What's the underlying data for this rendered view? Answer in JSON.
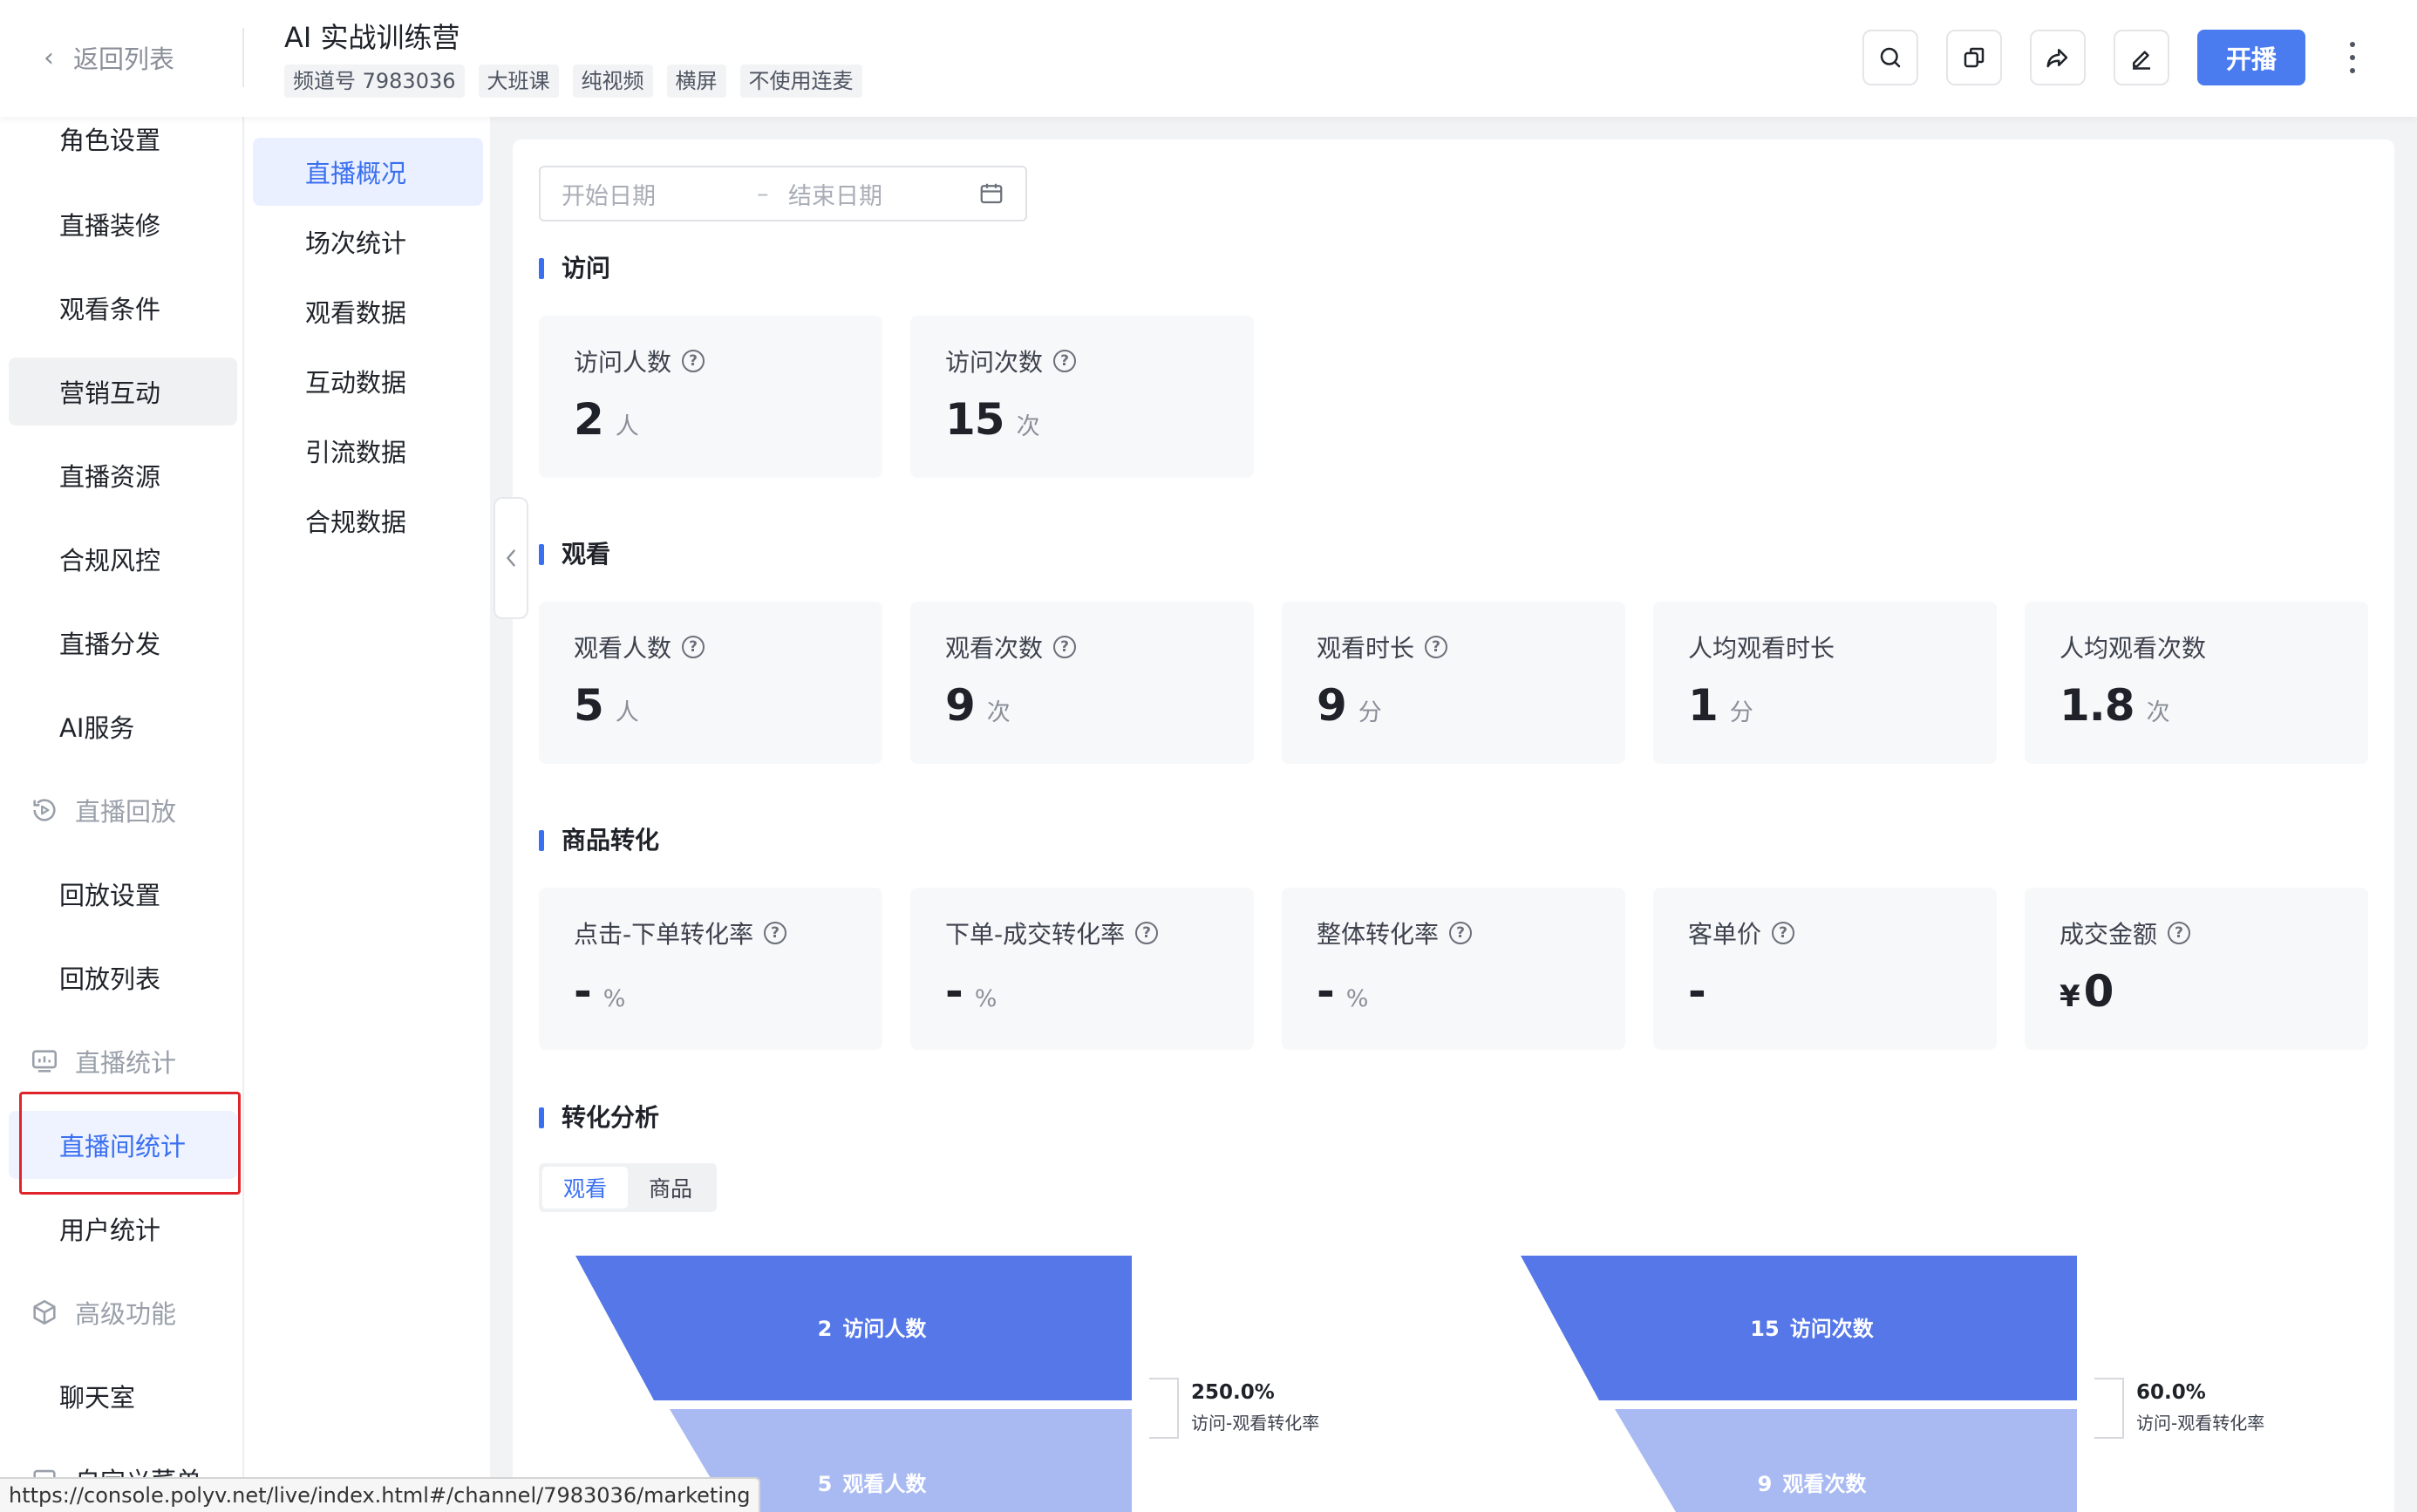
{
  "header": {
    "back_label": "返回列表",
    "title": "AI 实战训练营",
    "tags": [
      "频道号 7983036",
      "大班课",
      "纯视频",
      "横屏",
      "不使用连麦"
    ],
    "start_button": "开播"
  },
  "sidebar": {
    "items": [
      {
        "label": "角色设置"
      },
      {
        "label": "直播装修"
      },
      {
        "label": "观看条件"
      },
      {
        "label": "营销互动"
      },
      {
        "label": "直播资源"
      },
      {
        "label": "合规风控"
      },
      {
        "label": "直播分发"
      },
      {
        "label": "AI服务"
      }
    ],
    "group_replay": "直播回放",
    "replay_items": [
      {
        "label": "回放设置"
      },
      {
        "label": "回放列表"
      }
    ],
    "group_stats": "直播统计",
    "stats_items": [
      {
        "label": "直播间统计"
      },
      {
        "label": "用户统计"
      }
    ],
    "group_advanced": "高级功能",
    "advanced_items": [
      {
        "label": "聊天室"
      },
      {
        "label": "自定义菜单"
      }
    ]
  },
  "subnav": {
    "items": [
      {
        "label": "直播概况"
      },
      {
        "label": "场次统计"
      },
      {
        "label": "观看数据"
      },
      {
        "label": "互动数据"
      },
      {
        "label": "引流数据"
      },
      {
        "label": "合规数据"
      }
    ]
  },
  "date_range": {
    "start_placeholder": "开始日期",
    "separator": "–",
    "end_placeholder": "结束日期"
  },
  "sections": {
    "visit": {
      "title": "访问",
      "cards": [
        {
          "label": "访问人数",
          "value": "2",
          "unit": "人"
        },
        {
          "label": "访问次数",
          "value": "15",
          "unit": "次"
        }
      ]
    },
    "watch": {
      "title": "观看",
      "cards": [
        {
          "label": "观看人数",
          "value": "5",
          "unit": "人"
        },
        {
          "label": "观看次数",
          "value": "9",
          "unit": "次"
        },
        {
          "label": "观看时长",
          "value": "9",
          "unit": "分"
        },
        {
          "label": "人均观看时长",
          "value": "1",
          "unit": "分"
        },
        {
          "label": "人均观看次数",
          "value": "1.8",
          "unit": "次"
        }
      ]
    },
    "goods": {
      "title": "商品转化",
      "cards": [
        {
          "label": "点击-下单转化率",
          "value": "-",
          "unit": "%"
        },
        {
          "label": "下单-成交转化率",
          "value": "-",
          "unit": "%"
        },
        {
          "label": "整体转化率",
          "value": "-",
          "unit": "%"
        },
        {
          "label": "客单价",
          "value": "-",
          "unit": ""
        },
        {
          "label": "成交金额",
          "prefix": "¥",
          "value": "0",
          "unit": ""
        }
      ]
    },
    "conversion": {
      "title": "转化分析",
      "tabs": [
        "观看",
        "商品"
      ]
    }
  },
  "funnels": [
    {
      "top_value": "2",
      "top_label": "访问人数",
      "bottom_value": "5",
      "bottom_label": "观看人数",
      "rate": "250.0%",
      "rate_label": "访问-观看转化率"
    },
    {
      "top_value": "15",
      "top_label": "访问次数",
      "bottom_value": "9",
      "bottom_label": "观看次数",
      "rate": "60.0%",
      "rate_label": "访问-观看转化率"
    }
  ],
  "colors": {
    "accent": "#4a7cf0",
    "funnel_top": "#5577e8",
    "funnel_bottom": "#a9baf3",
    "highlight_box": "#e0242c"
  },
  "status_url": "https://console.polyv.net/live/index.html#/channel/7983036/marketing"
}
